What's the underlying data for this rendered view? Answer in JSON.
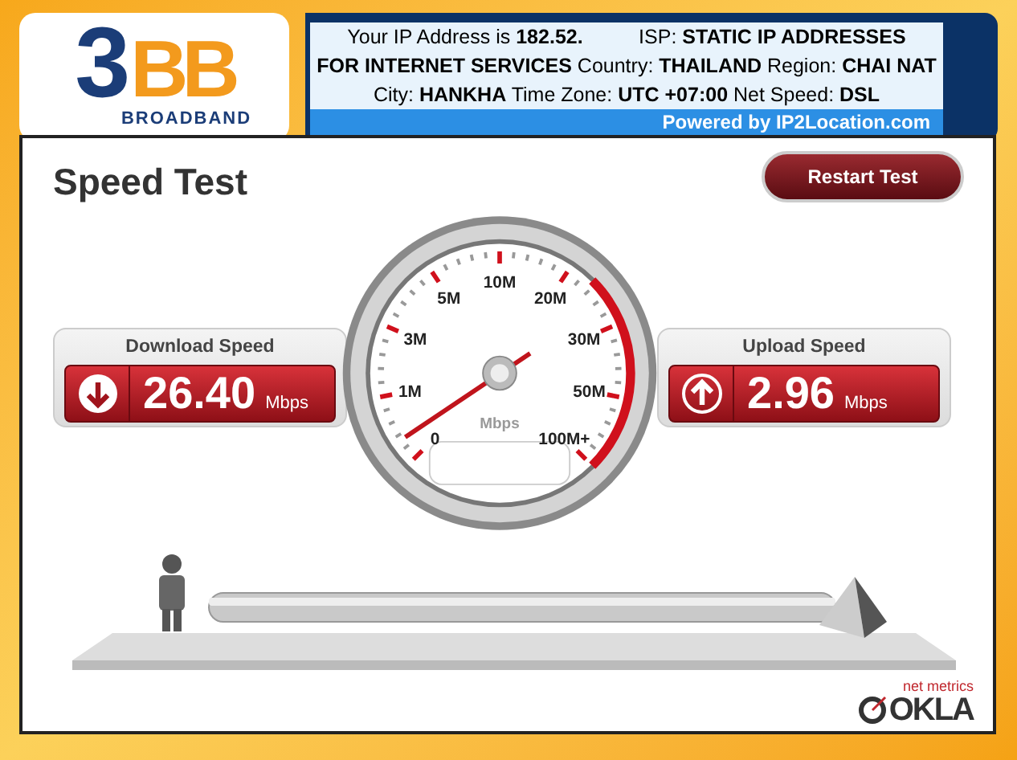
{
  "logo": {
    "number": "3",
    "letters": "BB",
    "tagline": "BROADBAND"
  },
  "ip_info": {
    "lines": [
      "Your IP Address is **182.52.**          ISP: **STATIC IP ADDRESSES**",
      "**FOR INTERNET SERVICES** Country: **THAILAND** Region: **CHAI NAT**",
      "City: **HANKHA** Time Zone: **UTC +07:00** Net Speed: **DSL**"
    ],
    "footer": "Powered by IP2Location.com"
  },
  "title": "Speed Test",
  "restart_button": "Restart Test",
  "download": {
    "label": "Download Speed",
    "value": "26.40",
    "unit": "Mbps"
  },
  "upload": {
    "label": "Upload Speed",
    "value": "2.96",
    "unit": "Mbps"
  },
  "gauge": {
    "labels": [
      "0",
      "1M",
      "3M",
      "5M",
      "10M",
      "20M",
      "30M",
      "50M",
      "100M+"
    ],
    "unit": "Mbps"
  },
  "brand": {
    "tagline": "net metrics",
    "name": "OKLA"
  }
}
